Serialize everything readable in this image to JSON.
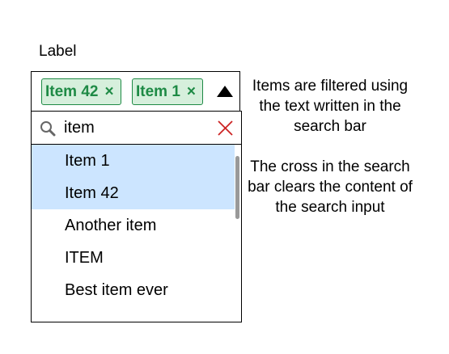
{
  "field": {
    "label": "Label"
  },
  "selected_chips": [
    {
      "label": "Item 42",
      "remove": "×"
    },
    {
      "label": "Item 1",
      "remove": "×"
    }
  ],
  "search": {
    "value": "item",
    "placeholder": ""
  },
  "options": [
    {
      "label": "Item 1",
      "selected": true
    },
    {
      "label": "Item 42",
      "selected": true
    },
    {
      "label": "Another item",
      "selected": false
    },
    {
      "label": "ITEM",
      "selected": false
    },
    {
      "label": "Best item ever",
      "selected": false
    }
  ],
  "help": {
    "line1": "Items are filtered using the text written in the search bar",
    "line2": "The cross in the search bar clears the content of the search input"
  },
  "icons": {
    "search": "search-icon",
    "clear": "close-icon",
    "toggle": "caret-up-icon"
  },
  "colors": {
    "chip_text": "#1e8a45",
    "chip_bg": "#d6efdc",
    "selected_bg": "#cce5ff",
    "clear": "#cc2222"
  }
}
